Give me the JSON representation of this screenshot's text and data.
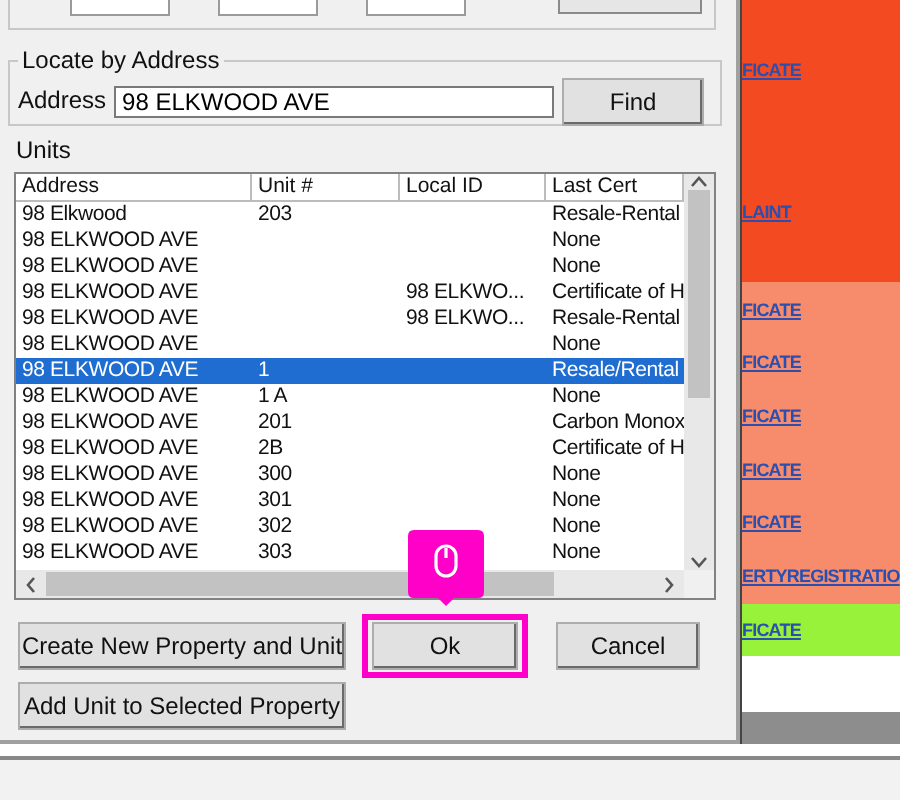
{
  "locate": {
    "title": "Locate by Address",
    "address_label": "Address",
    "address_value": "98 ELKWOOD AVE",
    "find_button": "Find"
  },
  "units": {
    "label": "Units",
    "columns": [
      "Address",
      "Unit #",
      "Local ID",
      "Last Cert"
    ],
    "rows": [
      {
        "cells": [
          "98 Elkwood",
          "203",
          "",
          "Resale-Rental"
        ],
        "selected": false
      },
      {
        "cells": [
          "98 ELKWOOD AVE",
          "",
          "",
          "None"
        ],
        "selected": false
      },
      {
        "cells": [
          "98 ELKWOOD AVE",
          "",
          "",
          "None"
        ],
        "selected": false
      },
      {
        "cells": [
          "98 ELKWOOD AVE",
          "",
          "98 ELKWO...",
          "Certificate of H"
        ],
        "selected": false
      },
      {
        "cells": [
          "98 ELKWOOD AVE",
          "",
          "98 ELKWO...",
          "Resale-Rental"
        ],
        "selected": false
      },
      {
        "cells": [
          "98 ELKWOOD AVE",
          "",
          "",
          "None"
        ],
        "selected": false
      },
      {
        "cells": [
          "98 ELKWOOD AVE",
          "1",
          "",
          "Resale/Rental"
        ],
        "selected": true
      },
      {
        "cells": [
          "98 ELKWOOD AVE",
          "1 A",
          "",
          "None"
        ],
        "selected": false
      },
      {
        "cells": [
          "98 ELKWOOD AVE",
          "201",
          "",
          "Carbon Monox"
        ],
        "selected": false
      },
      {
        "cells": [
          "98 ELKWOOD AVE",
          "2B",
          "",
          "Certificate of H"
        ],
        "selected": false
      },
      {
        "cells": [
          "98 ELKWOOD AVE",
          "300",
          "",
          "None"
        ],
        "selected": false
      },
      {
        "cells": [
          "98 ELKWOOD AVE",
          "301",
          "",
          "None"
        ],
        "selected": false
      },
      {
        "cells": [
          "98 ELKWOOD AVE",
          "302",
          "",
          "None"
        ],
        "selected": false
      },
      {
        "cells": [
          "98 ELKWOOD AVE",
          "303",
          "",
          "None"
        ],
        "selected": false
      }
    ]
  },
  "buttons": {
    "create": "Create New Property and Unit",
    "ok": "Ok",
    "cancel": "Cancel",
    "add_unit": "Add Unit to Selected Property"
  },
  "background_rows": [
    {
      "color": "#f44a22",
      "links": [
        "FICATE",
        "LAINT"
      ]
    },
    {
      "color": "#f78c6c",
      "links": [
        "FICATE",
        "FICATE",
        "FICATE",
        "FICATE",
        "FICATE",
        "ERTYREGISTRATIO"
      ]
    },
    {
      "color": "#99f23a",
      "links": [
        "FICATE"
      ]
    }
  ]
}
